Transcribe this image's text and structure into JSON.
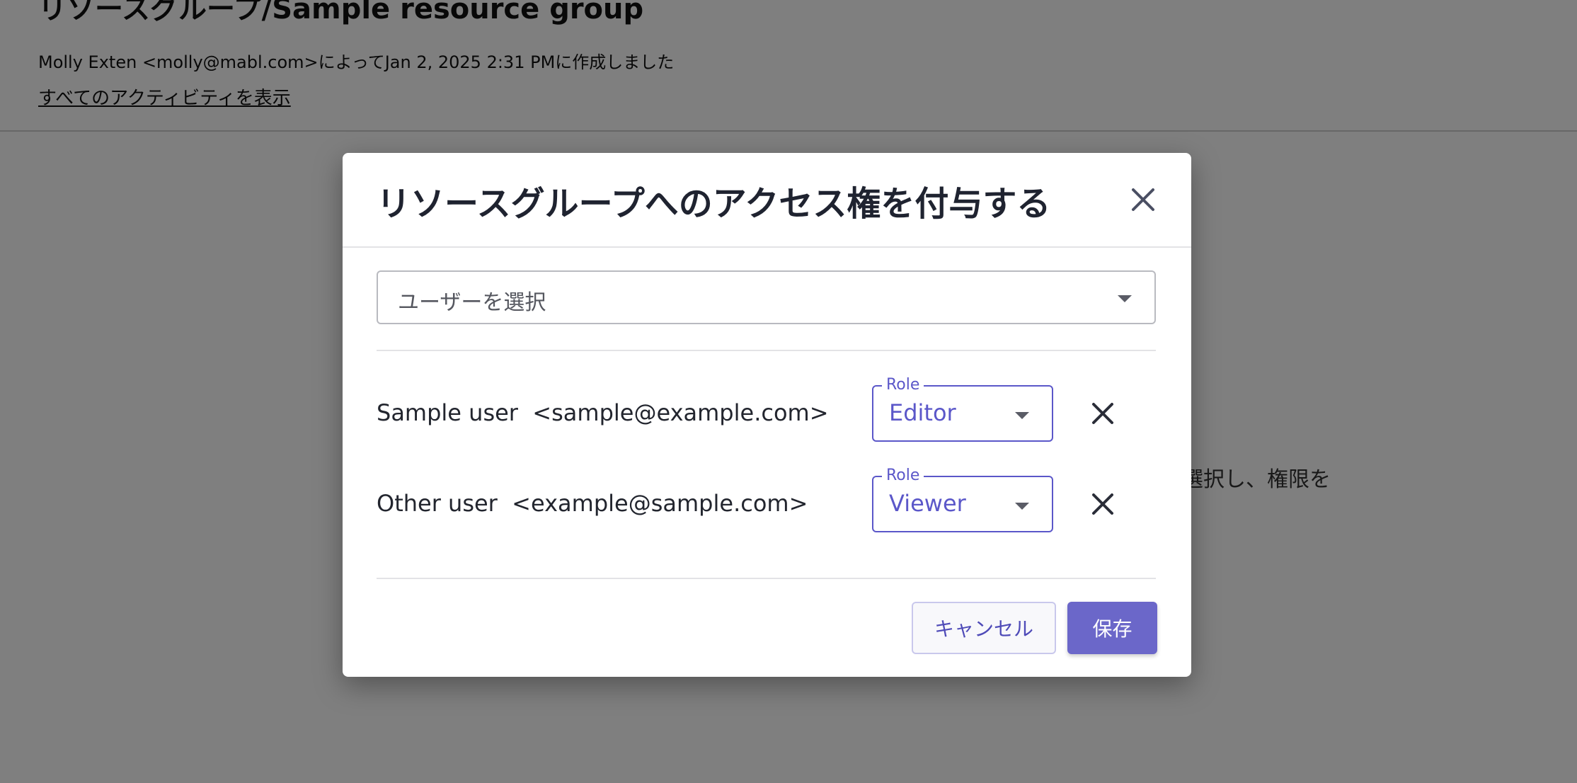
{
  "background": {
    "page_title": "リソースグループ/Sample resource group",
    "meta": "Molly Exten <molly@mabl.com>によってJan 2, 2025 2:31 PMに作成しました",
    "activity_link": "すべてのアクティビティを表示",
    "hint_fragment": "選択し、権限を"
  },
  "dialog": {
    "title": "リソースグループへのアクセス権を付与する",
    "close_icon": "close-icon",
    "user_select": {
      "placeholder": "ユーザーを選択",
      "icon": "chevron-down-icon"
    },
    "users": [
      {
        "name": "Sample user",
        "email": "<sample@example.com>",
        "role_label": "Role",
        "role": "Editor"
      },
      {
        "name": "Other user",
        "email": "<example@sample.com>",
        "role_label": "Role",
        "role": "Viewer"
      }
    ],
    "cancel_label": "キャンセル",
    "save_label": "保存"
  },
  "colors": {
    "accent": "#6b67c9",
    "accent_text": "#5b57c9",
    "overlay": "rgba(0,0,0,0.5)"
  }
}
